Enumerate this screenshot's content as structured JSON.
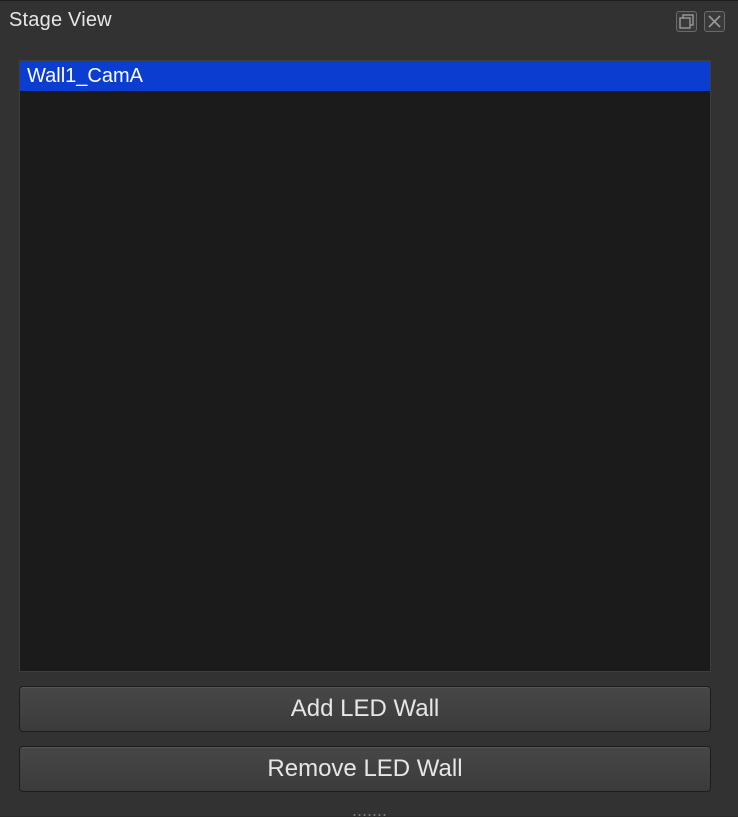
{
  "window": {
    "title": "Stage View"
  },
  "title_buttons": {
    "float_icon": "float-window-icon",
    "close_icon": "close-icon"
  },
  "led_walls": {
    "items": [
      {
        "label": "Wall1_CamA",
        "selected": true
      }
    ]
  },
  "actions": {
    "add_label": "Add LED Wall",
    "remove_label": "Remove LED Wall"
  },
  "colors": {
    "selection": "#0b3ed0",
    "panel_bg": "#323232",
    "list_bg": "#1b1b1b"
  }
}
